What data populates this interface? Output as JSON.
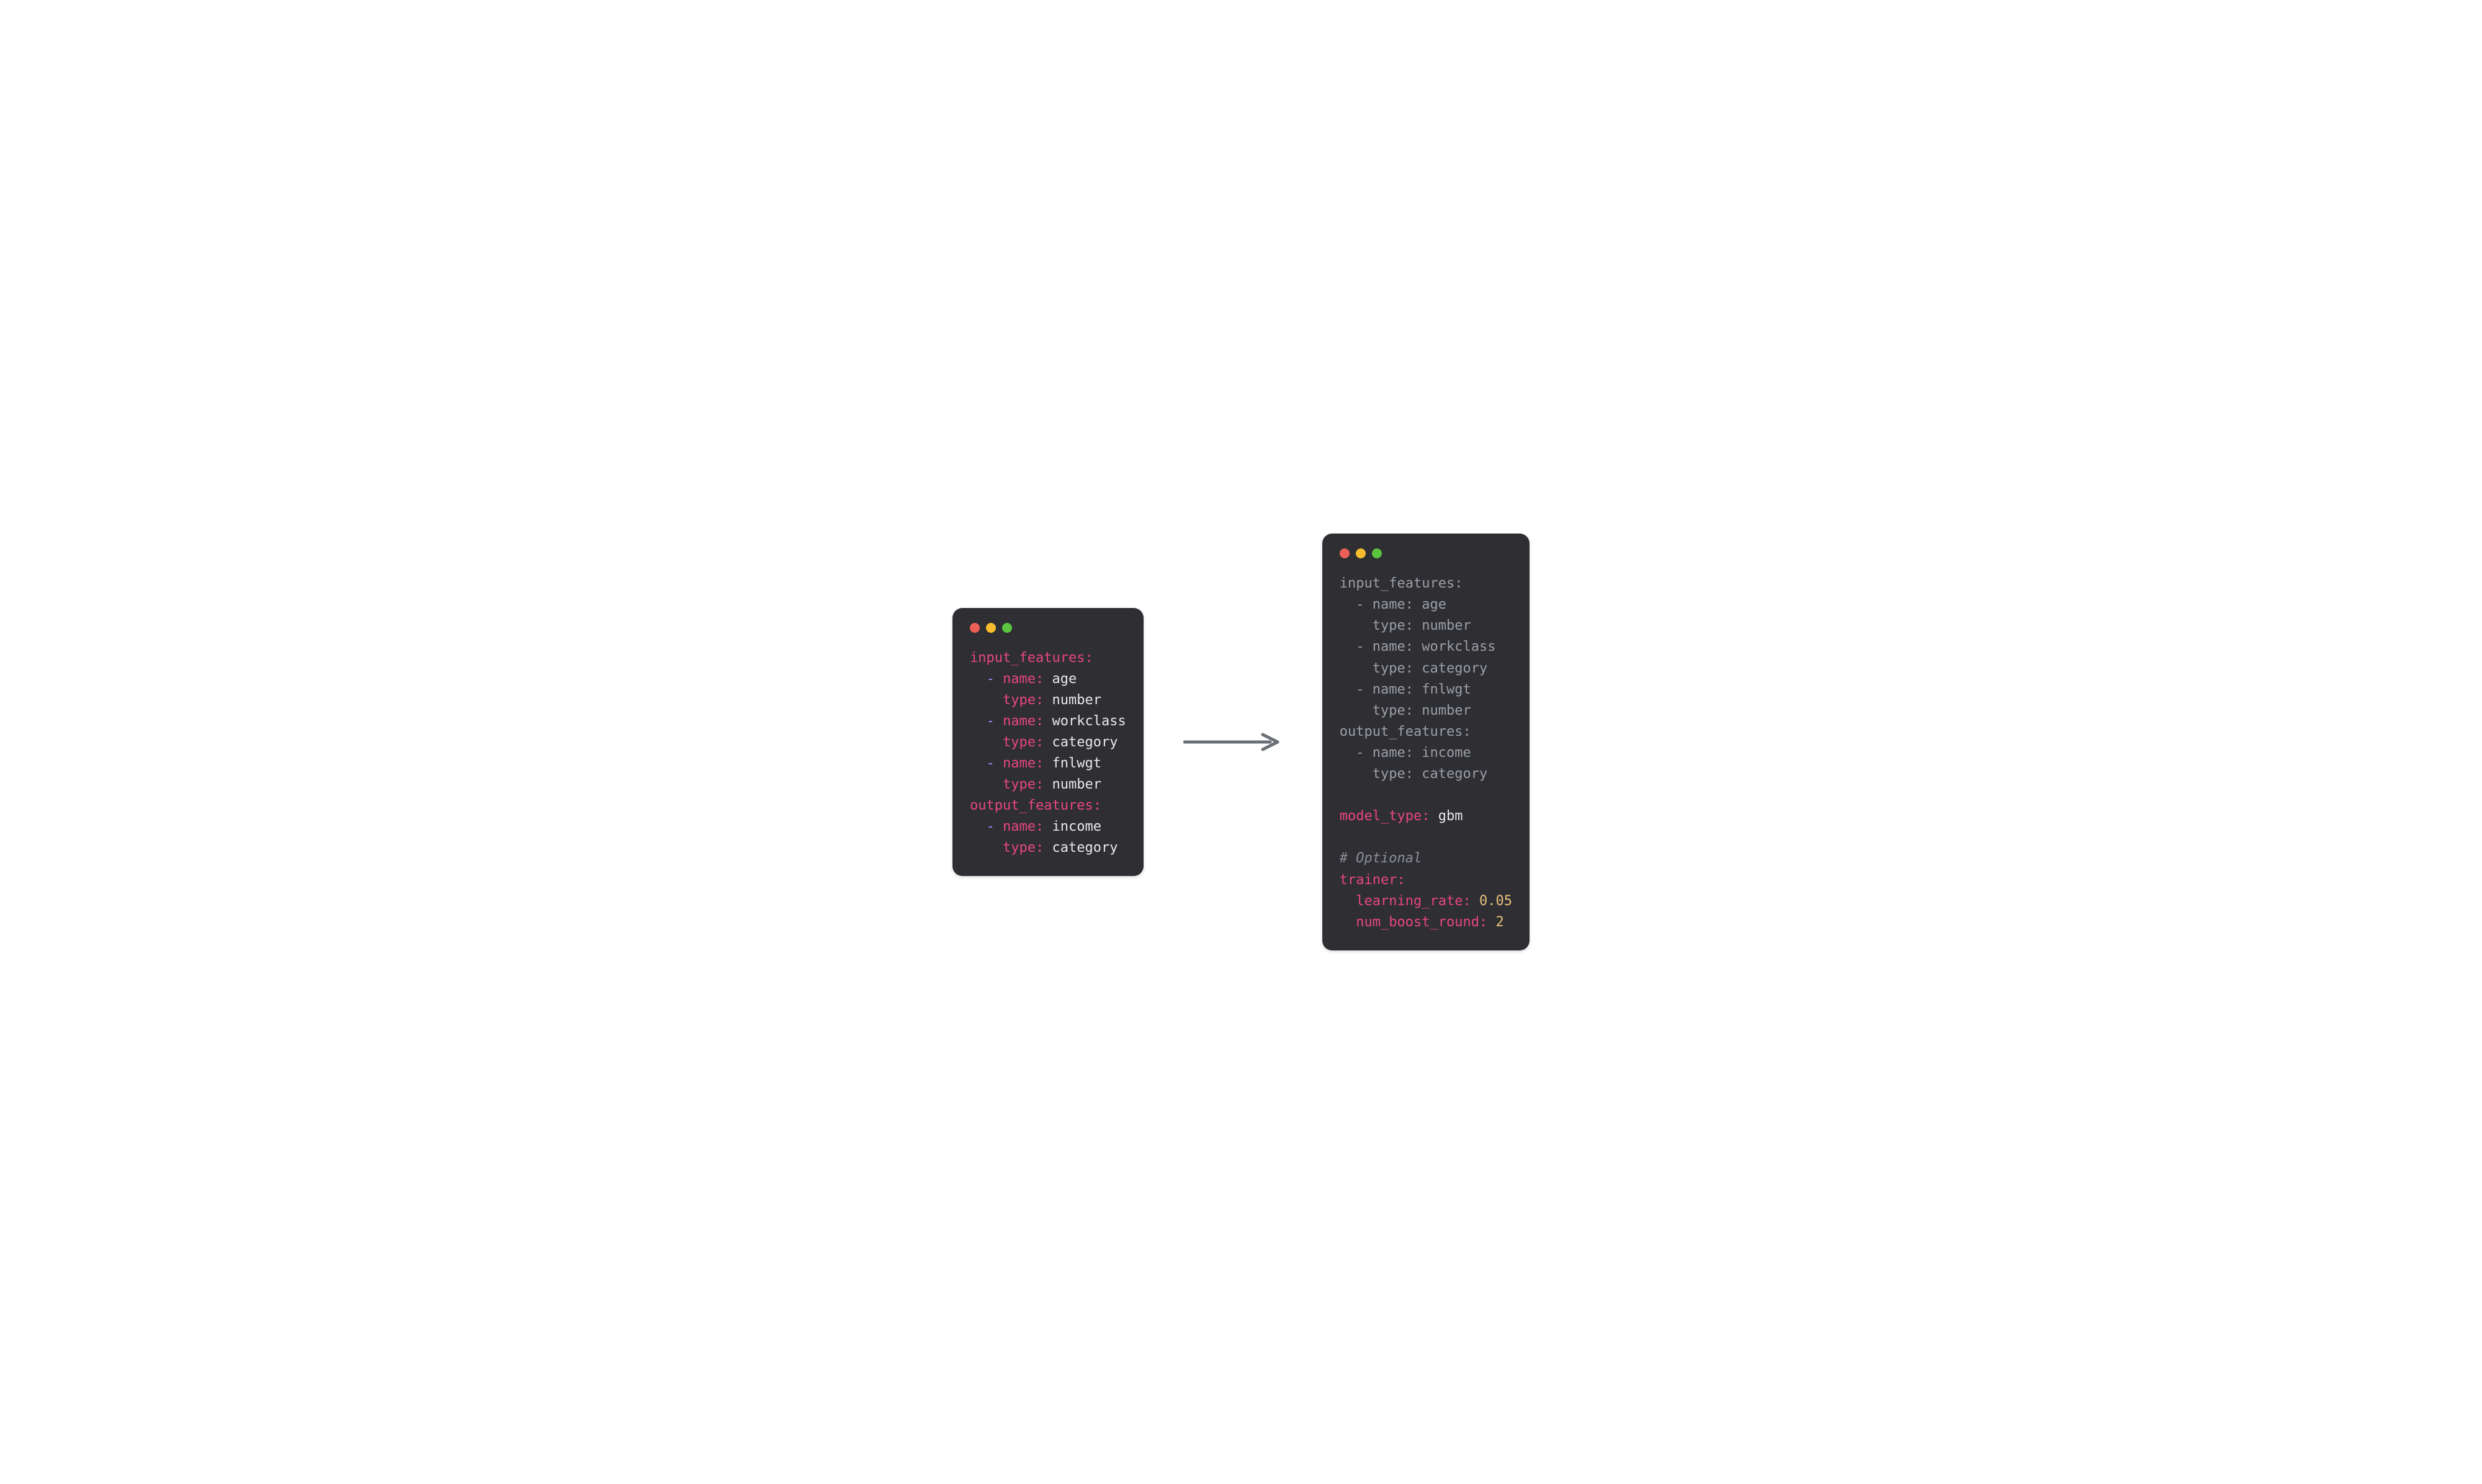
{
  "left": {
    "input_features": [
      {
        "name": "age",
        "type": "number"
      },
      {
        "name": "workclass",
        "type": "category"
      },
      {
        "name": "fnlwgt",
        "type": "number"
      }
    ],
    "output_features": [
      {
        "name": "income",
        "type": "category"
      }
    ]
  },
  "right": {
    "input_features": [
      {
        "name": "age",
        "type": "number"
      },
      {
        "name": "workclass",
        "type": "category"
      },
      {
        "name": "fnlwgt",
        "type": "number"
      }
    ],
    "output_features": [
      {
        "name": "income",
        "type": "category"
      }
    ],
    "model_type": "gbm",
    "comment": "# Optional",
    "trainer": {
      "learning_rate": "0.05",
      "num_boost_round": "2"
    }
  },
  "labels": {
    "input_features": "input_features",
    "output_features": "output_features",
    "name": "name",
    "type": "type",
    "model_type": "model_type",
    "trainer": "trainer",
    "learning_rate": "learning_rate",
    "num_boost_round": "num_boost_round"
  },
  "colors": {
    "window_bg": "#2e2e33",
    "key": "#e8477d",
    "value": "#e8e8e8",
    "dash": "#9d8cff",
    "number": "#e7c07b",
    "comment": "#8a8f99",
    "muted": "#9aa0a6",
    "arrow": "#6b6f76"
  }
}
